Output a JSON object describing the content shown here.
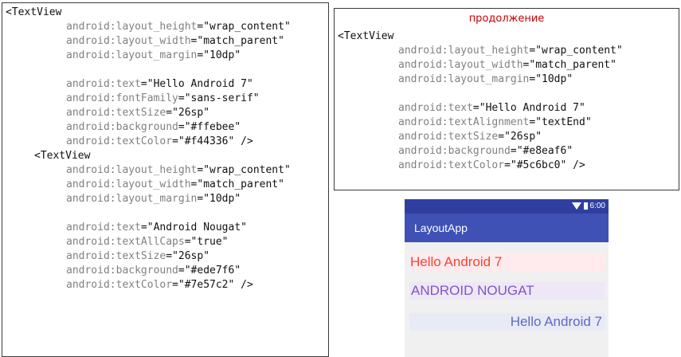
{
  "left_code": [
    {
      "kind": "tag",
      "indent": 0,
      "text": "<TextView"
    },
    {
      "kind": "attr",
      "indent": 1,
      "name": "android:layout_height",
      "value": "\"wrap_content\""
    },
    {
      "kind": "attr",
      "indent": 1,
      "name": "android:layout_width",
      "value": "\"match_parent\""
    },
    {
      "kind": "attr",
      "indent": 1,
      "name": "android:layout_margin",
      "value": "\"10dp\""
    },
    {
      "kind": "blank"
    },
    {
      "kind": "attr",
      "indent": 1,
      "name": "android:text",
      "value": "\"Hello Android 7\""
    },
    {
      "kind": "attr",
      "indent": 1,
      "name": "android:fontFamily",
      "value": "\"sans-serif\""
    },
    {
      "kind": "attr",
      "indent": 1,
      "name": "android:textSize",
      "value": "\"26sp\""
    },
    {
      "kind": "attr",
      "indent": 1,
      "name": "android:background",
      "value": "\"#ffebee\""
    },
    {
      "kind": "attr",
      "indent": 1,
      "name": "android:textColor",
      "value": "\"#f44336\" />"
    },
    {
      "kind": "tag",
      "indent": 2,
      "text": "<TextView"
    },
    {
      "kind": "attr",
      "indent": 1,
      "name": "android:layout_height",
      "value": "\"wrap_content\""
    },
    {
      "kind": "attr",
      "indent": 1,
      "name": "android:layout_width",
      "value": "\"match_parent\""
    },
    {
      "kind": "attr",
      "indent": 1,
      "name": "android:layout_margin",
      "value": "\"10dp\""
    },
    {
      "kind": "blank"
    },
    {
      "kind": "attr",
      "indent": 1,
      "name": "android:text",
      "value": "\"Android Nougat\""
    },
    {
      "kind": "attr",
      "indent": 1,
      "name": "android:textAllCaps",
      "value": "\"true\""
    },
    {
      "kind": "attr",
      "indent": 1,
      "name": "android:textSize",
      "value": "\"26sp\""
    },
    {
      "kind": "attr",
      "indent": 1,
      "name": "android:background",
      "value": "\"#ede7f6\""
    },
    {
      "kind": "attr",
      "indent": 1,
      "name": "android:textColor",
      "value": "\"#7e57c2\" />"
    }
  ],
  "right_header": "продолжение",
  "right_code": [
    {
      "kind": "tag",
      "indent": 0,
      "text": "<TextView"
    },
    {
      "kind": "attr",
      "indent": 1,
      "name": "android:layout_height",
      "value": "\"wrap_content\""
    },
    {
      "kind": "attr",
      "indent": 1,
      "name": "android:layout_width",
      "value": "\"match_parent\""
    },
    {
      "kind": "attr",
      "indent": 1,
      "name": "android:layout_margin",
      "value": "\"10dp\""
    },
    {
      "kind": "blank"
    },
    {
      "kind": "attr",
      "indent": 1,
      "name": "android:text",
      "value": "\"Hello Android 7\""
    },
    {
      "kind": "attr",
      "indent": 1,
      "name": "android:textAlignment",
      "value": "\"textEnd\""
    },
    {
      "kind": "attr",
      "indent": 1,
      "name": "android:textSize",
      "value": "\"26sp\""
    },
    {
      "kind": "attr",
      "indent": 1,
      "name": "android:background",
      "value": "\"#e8eaf6\""
    },
    {
      "kind": "attr",
      "indent": 1,
      "name": "android:textColor",
      "value": "\"#5c6bc0\" />"
    }
  ],
  "phone": {
    "time": "6:00",
    "app_title": "LayoutApp",
    "text1": "Hello Android 7",
    "text2": "ANDROID NOUGAT",
    "text3": "Hello Android 7",
    "colors": {
      "status_bar": "#303f9f",
      "toolbar": "#3f51b5",
      "text1_bg": "#ffebee",
      "text1_fg": "#f44336",
      "text2_bg": "#ede7f6",
      "text2_fg": "#7e57c2",
      "text3_bg": "#e8eaf6",
      "text3_fg": "#5c6bc0"
    }
  }
}
